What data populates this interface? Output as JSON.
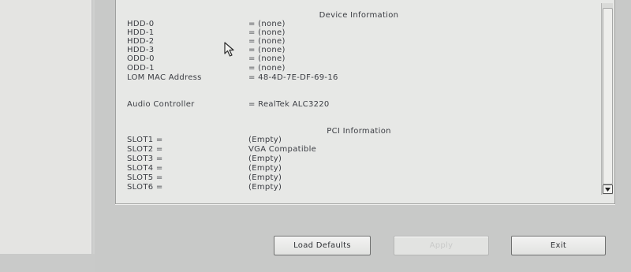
{
  "device_info": {
    "heading": "Device Information",
    "rows": [
      {
        "label": "HDD-0",
        "value": "= (none)"
      },
      {
        "label": "HDD-1",
        "value": "= (none)"
      },
      {
        "label": "HDD-2",
        "value": "= (none)"
      },
      {
        "label": "HDD-3",
        "value": "= (none)"
      },
      {
        "label": "ODD-0",
        "value": "= (none)"
      },
      {
        "label": "ODD-1",
        "value": "= (none)"
      },
      {
        "label": "LOM MAC Address",
        "value": "= 48-4D-7E-DF-69-16"
      }
    ],
    "audio": {
      "label": "Audio Controller",
      "value": "= RealTek ALC3220"
    }
  },
  "pci_info": {
    "heading": "PCI Information",
    "slots": [
      {
        "label": "SLOT1 =",
        "value": "(Empty)"
      },
      {
        "label": "SLOT2 =",
        "value": "VGA Compatible"
      },
      {
        "label": "SLOT3 =",
        "value": "(Empty)"
      },
      {
        "label": "SLOT4 =",
        "value": "(Empty)"
      },
      {
        "label": "SLOT5 =",
        "value": "(Empty)"
      },
      {
        "label": "SLOT6 =",
        "value": "(Empty)"
      }
    ]
  },
  "buttons": {
    "load_defaults": "Load Defaults",
    "apply": "Apply",
    "exit": "Exit"
  },
  "icons": {
    "cursor": "mouse-pointer-icon",
    "scroll_down": "chevron-down-icon"
  }
}
